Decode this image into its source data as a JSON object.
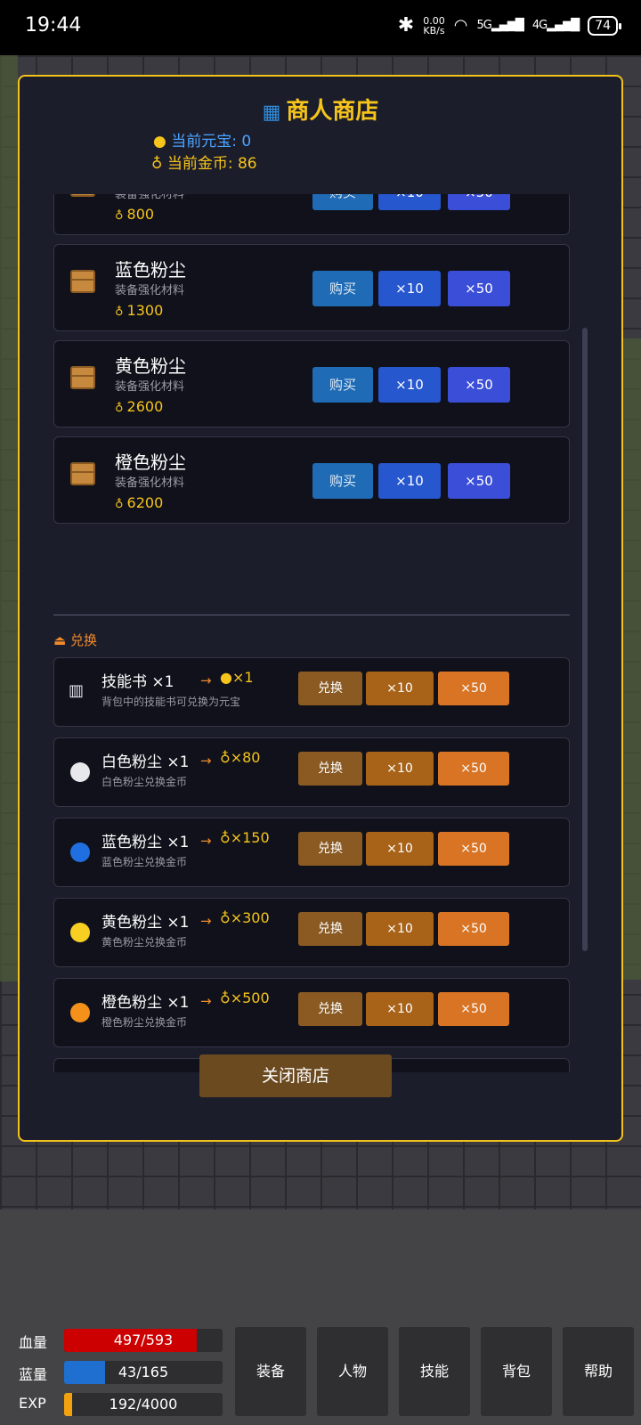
{
  "status": {
    "time": "19:44",
    "net_speed_top": "0.00",
    "net_speed_bottom": "KB/s",
    "sig1": "5G",
    "sig2": "4G",
    "battery": "74"
  },
  "shop": {
    "title": "商人商店",
    "yuanbao": "当前元宝: 0",
    "gold": "当前金币: 86",
    "buy_items": [
      {
        "name": "",
        "desc": "装备强化材料",
        "price": "800"
      },
      {
        "name": "蓝色粉尘",
        "desc": "装备强化材料",
        "price": "1300"
      },
      {
        "name": "黄色粉尘",
        "desc": "装备强化材料",
        "price": "2600"
      },
      {
        "name": "橙色粉尘",
        "desc": "装备强化材料",
        "price": "6200"
      }
    ],
    "buy_label": "购买",
    "x10_label": "×10",
    "x50_label": "×50",
    "exchange_section": "兑换",
    "exchange_label": "兑换",
    "exchange_items": [
      {
        "name": "技能书 ×1",
        "arrow": "→",
        "reward": "×1",
        "reward_icon": "coin",
        "desc": "背包中的技能书可兑换为元宝",
        "icon": "book",
        "color": ""
      },
      {
        "name": "白色粉尘 ×1",
        "arrow": "→",
        "reward": "×80",
        "reward_icon": "money-bag",
        "desc": "白色粉尘兑换金币",
        "icon": "white-circle",
        "color": "#e8e8ec"
      },
      {
        "name": "蓝色粉尘 ×1",
        "arrow": "→",
        "reward": "×150",
        "reward_icon": "money-bag",
        "desc": "蓝色粉尘兑换金币",
        "icon": "blue-circle",
        "color": "#1f6fe0"
      },
      {
        "name": "黄色粉尘 ×1",
        "arrow": "→",
        "reward": "×300",
        "reward_icon": "money-bag",
        "desc": "黄色粉尘兑换金币",
        "icon": "yellow-circle",
        "color": "#f6cf22"
      },
      {
        "name": "橙色粉尘 ×1",
        "arrow": "→",
        "reward": "×500",
        "reward_icon": "money-bag",
        "desc": "橙色粉尘兑换金币",
        "icon": "orange-circle",
        "color": "#f5901a"
      }
    ],
    "close_label": "关闭商店"
  },
  "hud": {
    "hp_label": "血量",
    "hp_text": "497/593",
    "hp_ratio": 0.838,
    "mp_label": "蓝量",
    "mp_text": "43/165",
    "mp_ratio": 0.26,
    "exp_label": "EXP",
    "exp_text": "192/4000",
    "exp_ratio": 0.048,
    "buttons": [
      "装备",
      "人物",
      "技能",
      "背包",
      "帮助"
    ],
    "colors": {
      "hp": "#cc0000",
      "mp": "#1e6fd0",
      "exp": "#f2a10f"
    }
  }
}
